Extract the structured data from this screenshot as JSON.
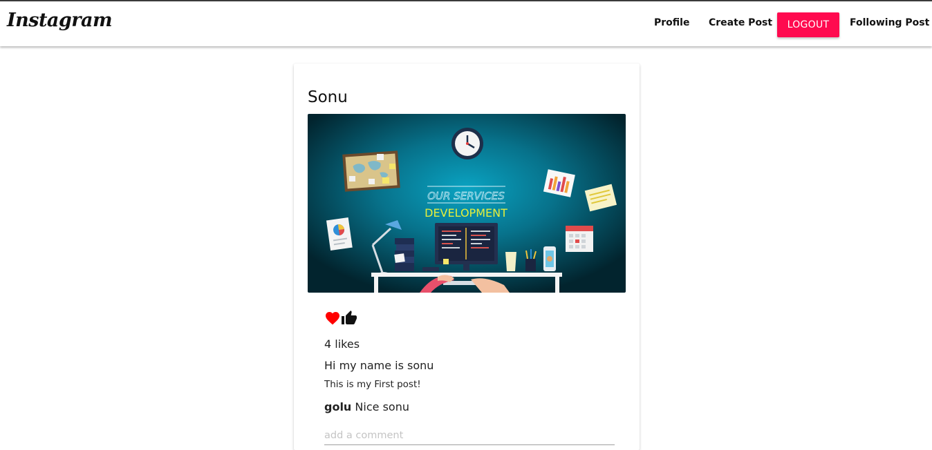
{
  "navbar": {
    "logo": "Instagram",
    "links": {
      "profile": "Profile",
      "create_post": "Create Post",
      "logout": "LOGOUT",
      "following_post": "Following Post"
    }
  },
  "post": {
    "author": "Sonu",
    "image": {
      "heading": "OUR SERVICES",
      "subheading": "DEVELOPMENT"
    },
    "likes": "4 likes",
    "title": "Hi my name is sonu",
    "body": "This is my First post!",
    "comments": [
      {
        "user": "golu",
        "text": "Nice sonu"
      }
    ],
    "comment_placeholder": "add a comment"
  },
  "colors": {
    "logout_button": "#ff0a4f",
    "heart": "#ff0000",
    "image_background": "#0a6f86"
  },
  "icons": {
    "like": "heart-icon",
    "thumb": "thumbs-up-icon"
  }
}
